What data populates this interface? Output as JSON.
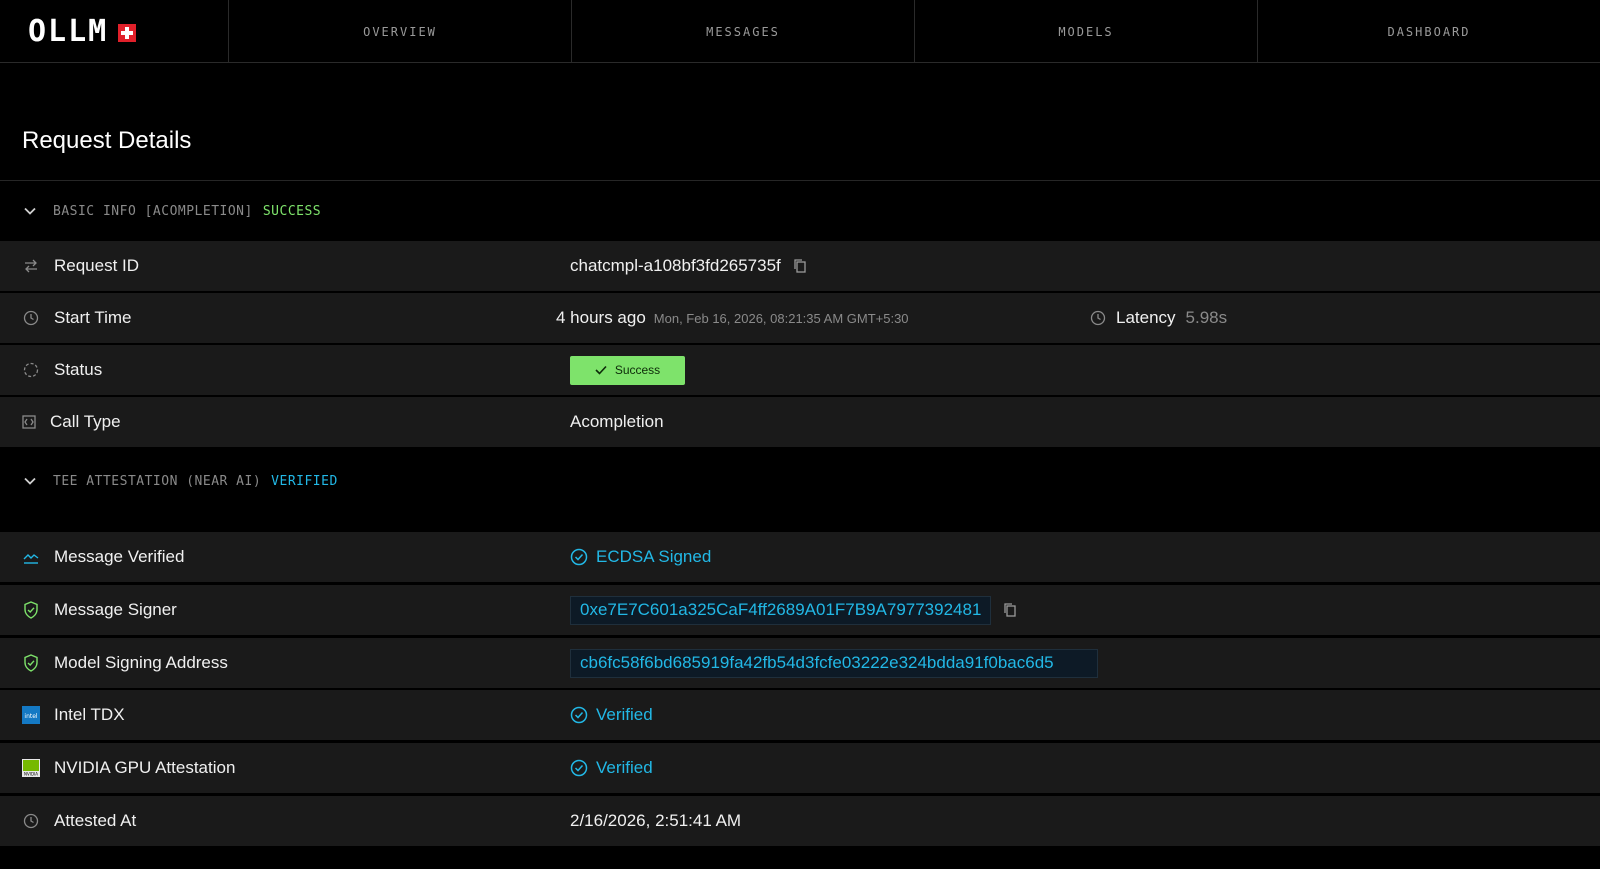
{
  "nav": {
    "logo_text": "OLLM",
    "tabs": [
      "OVERVIEW",
      "MESSAGES",
      "MODELS",
      "DASHBOARD"
    ]
  },
  "page_title": "Request Details",
  "basic_info": {
    "header_text": "BASIC INFO [ACOMPLETION]",
    "header_status": "SUCCESS",
    "rows": {
      "request_id": {
        "label": "Request ID",
        "value": "chatcmpl-a108bf3fd265735f"
      },
      "start_time": {
        "label": "Start Time",
        "relative": "4 hours ago",
        "absolute": "Mon, Feb 16, 2026, 08:21:35 AM GMT+5:30",
        "latency_label": "Latency",
        "latency_value": "5.98s"
      },
      "status": {
        "label": "Status",
        "badge": "Success"
      },
      "call_type": {
        "label": "Call Type",
        "value": "Acompletion"
      }
    }
  },
  "tee": {
    "header_text": "TEE ATTESTATION (NEAR AI)",
    "header_status": "VERIFIED",
    "rows": {
      "message_verified": {
        "label": "Message Verified",
        "value": "ECDSA Signed"
      },
      "message_signer": {
        "label": "Message Signer",
        "value": "0xe7E7C601a325CaF4ff2689A01F7B9A7977392481"
      },
      "model_signing_address": {
        "label": "Model Signing Address",
        "value": "cb6fc58f6bd685919fa42fb54d3fcfe03222e324bdda91f0bac6d5"
      },
      "intel_tdx": {
        "label": "Intel TDX",
        "value": "Verified",
        "icon_text": "intel"
      },
      "nvidia": {
        "label": "NVIDIA GPU Attestation",
        "value": "Verified",
        "icon_text": "NVIDIA"
      },
      "attested_at": {
        "label": "Attested At",
        "value": "2/16/2026, 2:51:41 AM"
      }
    }
  },
  "colors": {
    "success": "#7ee36b",
    "verified": "#22b8e6",
    "row_bg": "#1a1a1a",
    "brand_red": "#e0202a"
  },
  "icons": [
    "swap-arrows-icon",
    "clock-icon",
    "loading-circle-icon",
    "code-box-icon",
    "chart-line-icon",
    "shield-check-icon",
    "intel-logo-icon",
    "nvidia-logo-icon",
    "check-circle-icon",
    "copy-icon",
    "chevron-down-icon",
    "swiss-cross-icon"
  ]
}
